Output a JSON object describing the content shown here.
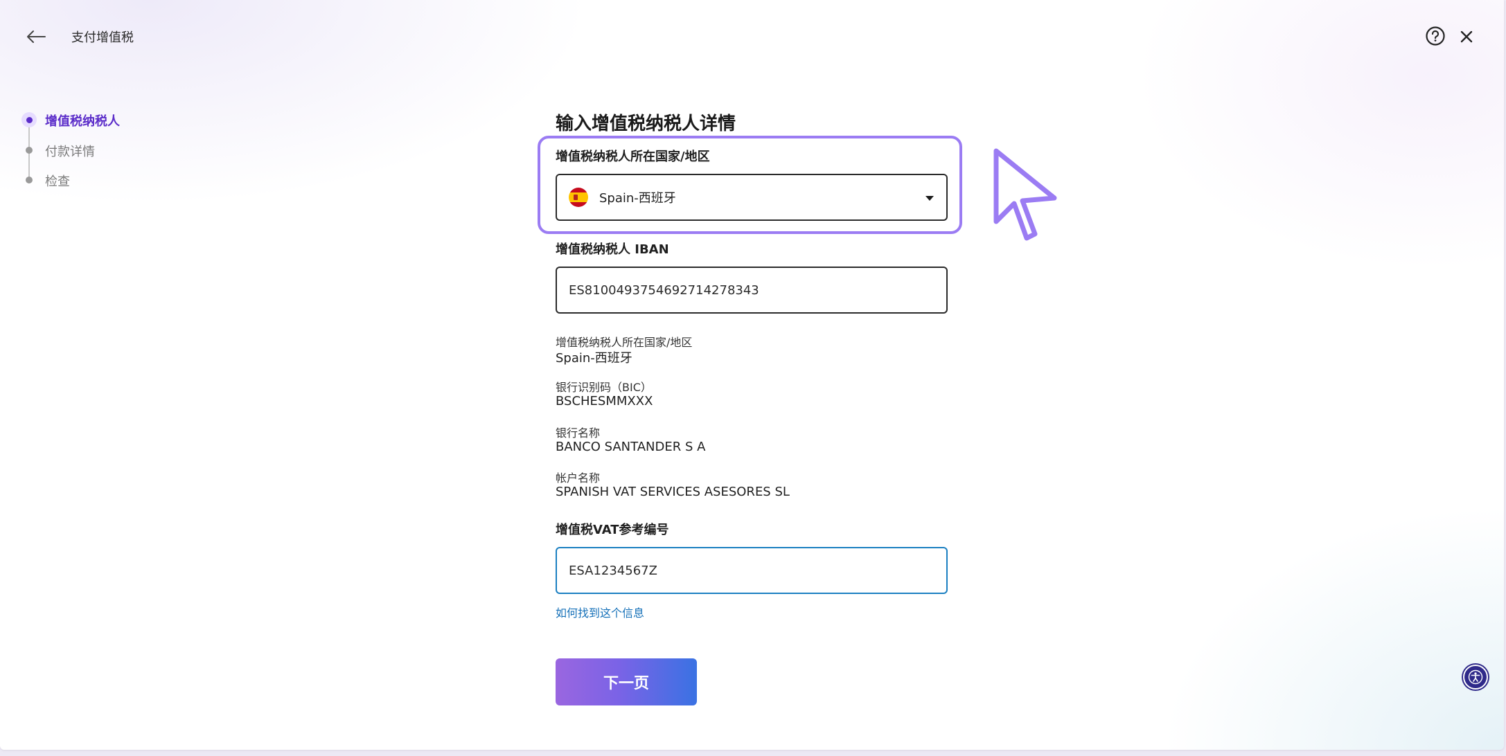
{
  "header": {
    "title": "支付增值税",
    "back_icon": "arrow-left-icon",
    "help_icon": "question-circle-icon",
    "close_icon": "close-icon"
  },
  "stepper": {
    "steps": [
      {
        "label": "增值税纳税人",
        "active": true
      },
      {
        "label": "付款详情",
        "active": false
      },
      {
        "label": "检查",
        "active": false
      }
    ],
    "active_color": "#5b2cc9"
  },
  "form": {
    "title": "输入增值税纳税人详情",
    "country": {
      "label": "增值税纳税人所在国家/地区",
      "value": "Spain-西班牙",
      "flag_icon": "spain-flag-icon"
    },
    "iban": {
      "label": "增值税纳税人 IBAN",
      "value": "ES8100493754692714278343"
    },
    "details": [
      {
        "label": "增值税纳税人所在国家/地区",
        "value": "Spain-西班牙"
      },
      {
        "label": "银行识别码（BIC）",
        "value": "BSCHESMMXXX"
      },
      {
        "label": "银行名称",
        "value": "BANCO SANTANDER S A"
      },
      {
        "label": "帐户名称",
        "value": "SPANISH VAT SERVICES ASESORES SL"
      }
    ],
    "vat_ref": {
      "label": "增值税VAT参考编号",
      "value": "ESA1234567Z"
    },
    "help_link": "如何找到这个信息",
    "next_button": "下一页"
  },
  "colors": {
    "highlight": "#9b7cf3",
    "link": "#1570b8",
    "focus_border": "#1a7fc1",
    "button_gradient_start": "#9a66e0",
    "button_gradient_end": "#3a72e3"
  },
  "accessibility_icon": "accessibility-icon"
}
